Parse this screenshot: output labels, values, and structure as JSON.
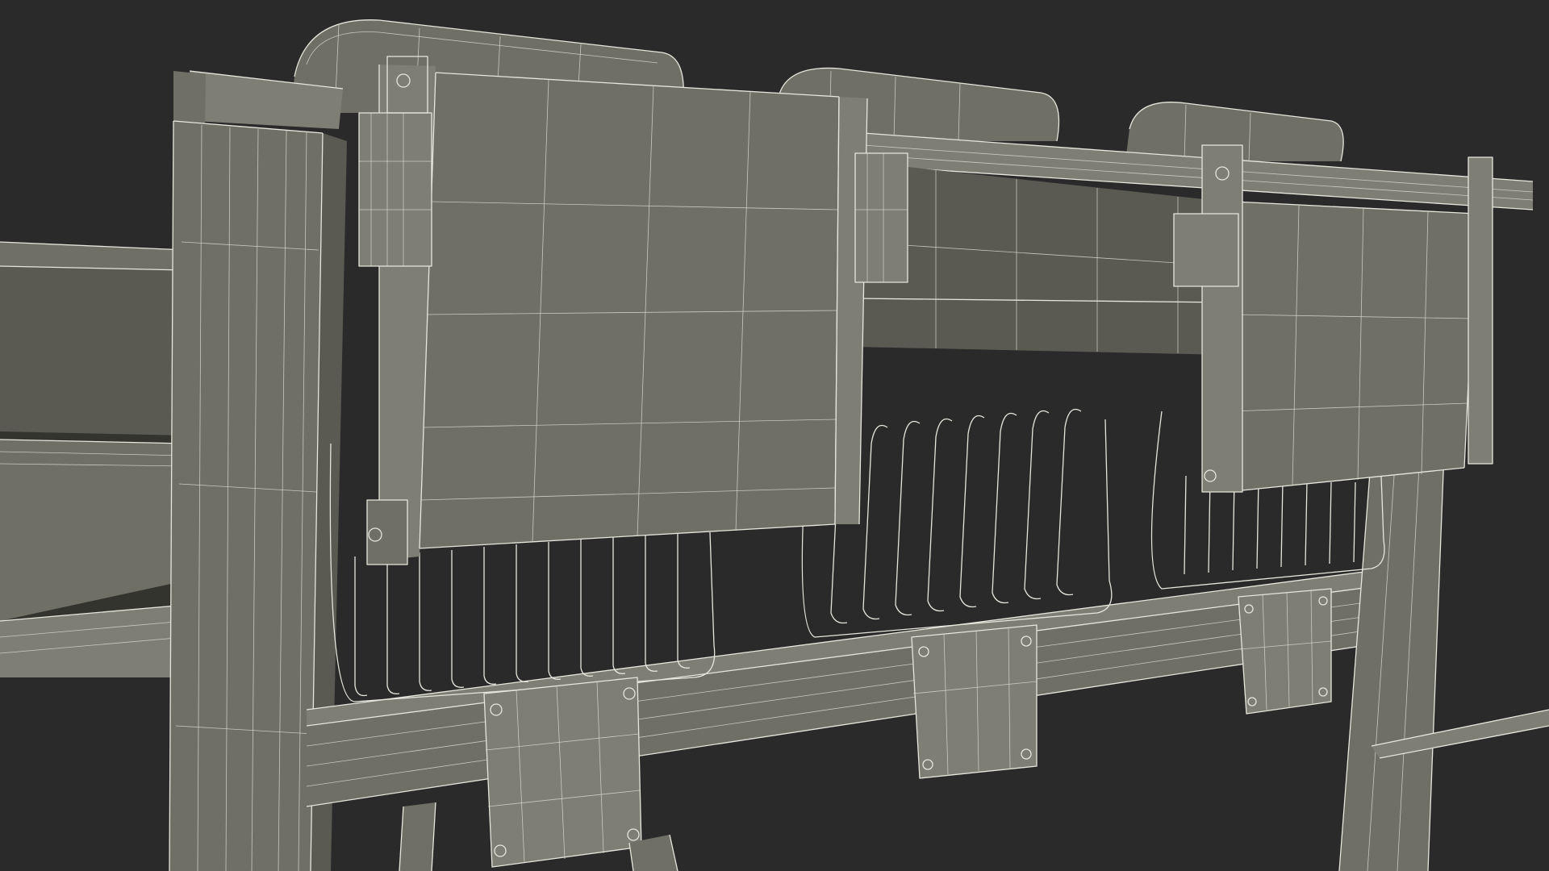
{
  "scene": {
    "subject": "wireframe-render-seating-row",
    "background_color": "#2a2a2a",
    "wire_color": "#e6e6dc",
    "surface_colors": {
      "dark": "#5a5a52",
      "mid": "#6f6f66",
      "light": "#7e7e74",
      "shadow": "#34342f"
    },
    "seat_count": 3,
    "basket_count": 3,
    "bolted_bracket_count": 3
  }
}
